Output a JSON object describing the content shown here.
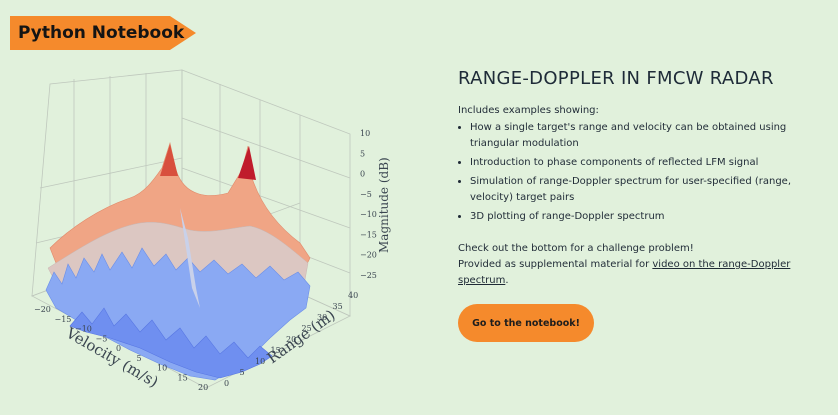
{
  "badge": {
    "label": "Python Notebook"
  },
  "plot": {
    "magnitude_axis_label": "Magnitude (dB)",
    "magnitude_ticks": [
      "10",
      "5",
      "0",
      "−5",
      "−10",
      "−15",
      "−20",
      "−25"
    ],
    "velocity_axis_label": "Velocity (m/s)",
    "velocity_ticks": [
      "−20",
      "−15",
      "−10",
      "−5",
      "0",
      "5",
      "10",
      "15",
      "20"
    ],
    "range_axis_label": "Range (m)",
    "range_ticks": [
      "0",
      "5",
      "10",
      "15",
      "20",
      "25",
      "30",
      "35",
      "40"
    ]
  },
  "content": {
    "title": "RANGE-DOPPLER IN FMCW RADAR",
    "intro": "Includes examples showing:",
    "bullets": [
      "How a single target's range and velocity can be obtained using triangular modulation",
      "Introduction to phase components of reflected LFM signal",
      "Simulation of range-Doppler spectrum for user-specified (range, velocity) target pairs",
      "3D plotting of range-Doppler spectrum"
    ],
    "challenge": "Check out the bottom for a challenge problem!",
    "provided_prefix": "Provided as supplemental material for ",
    "video_link": "video on the range-Doppler spectrum",
    "provided_suffix": "."
  },
  "button": {
    "label": "Go to the notebook!"
  },
  "colors": {
    "accent": "#f58a2c",
    "background": "#e1f1dc"
  }
}
